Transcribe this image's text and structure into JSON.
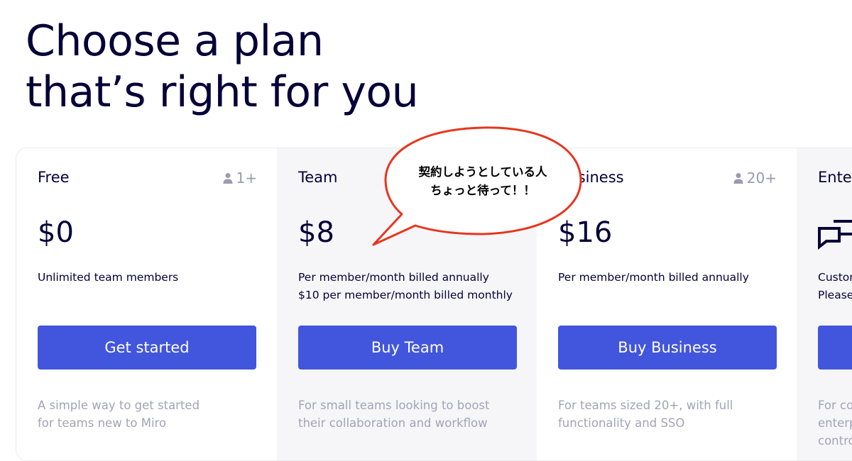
{
  "heading": {
    "line1": "Choose a plan",
    "line2": "that’s right for you"
  },
  "plans": [
    {
      "name": "Free",
      "team_size": "1+",
      "price": "$0",
      "desc1": "Unlimited team members",
      "desc2": "",
      "cta": "Get started",
      "tagline1": "A simple way to get started",
      "tagline2": "for teams new to Miro"
    },
    {
      "name": "Team",
      "team_size": "",
      "price": "$8",
      "desc1": "Per member/month billed annually",
      "desc2": "$10 per member/month billed monthly",
      "cta": "Buy Team",
      "tagline1": "For small teams looking to boost",
      "tagline2": "their collaboration and workflow"
    },
    {
      "name": "Business",
      "team_size": "20+",
      "price": "$16",
      "desc1": "Per member/month billed annually",
      "desc2": "",
      "cta": "Buy Business",
      "tagline1": "For teams sized 20+, with full",
      "tagline2": "functionality and SSO"
    },
    {
      "name": "Enterprise",
      "team_size": "",
      "price": "",
      "desc1": "Custom",
      "desc2": "Please",
      "cta": "",
      "tagline1": "For co",
      "tagline2": "enterp",
      "tagline3": "contro"
    }
  ],
  "bubble": {
    "line1": "契約しようとしている人",
    "line2": "ちょっと待って！！"
  },
  "colors": {
    "primary": "#4255dd",
    "text": "#050038",
    "muted": "#a3a3b8",
    "bubble_border": "#e8351e"
  }
}
